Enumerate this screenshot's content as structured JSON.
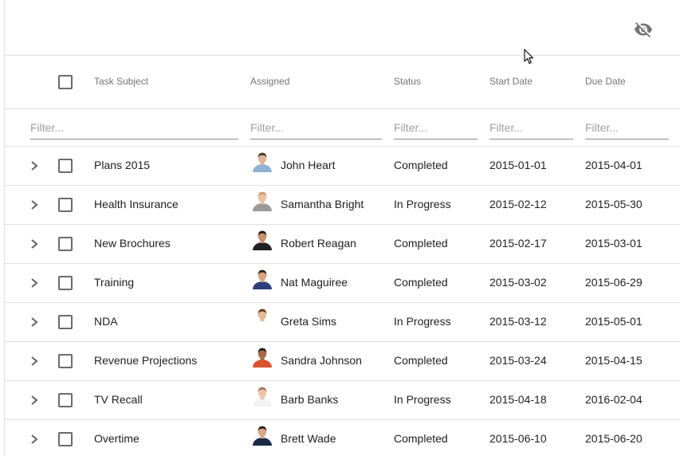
{
  "columns": {
    "task_subject": "Task Subject",
    "assigned": "Assigned",
    "status": "Status",
    "start_date": "Start Date",
    "due_date": "Due Date"
  },
  "filters": {
    "placeholder": "Filter..."
  },
  "toolbar": {
    "hide_icon": "eye-off-icon"
  },
  "rows": [
    {
      "subject": "Plans 2015",
      "assigned": "John Heart",
      "status": "Completed",
      "start": "2015-01-01",
      "due": "2015-04-01",
      "avatar": {
        "skin": "#e0b49a",
        "hair": "#4a3323",
        "shirt": "#8fb3d6"
      }
    },
    {
      "subject": "Health Insurance",
      "assigned": "Samantha Bright",
      "status": "In Progress",
      "start": "2015-02-12",
      "due": "2015-05-30",
      "avatar": {
        "skin": "#e9c3a6",
        "hair": "#c9a26b",
        "shirt": "#9a9a9a"
      }
    },
    {
      "subject": "New Brochures",
      "assigned": "Robert Reagan",
      "status": "Completed",
      "start": "2015-02-17",
      "due": "2015-03-01",
      "avatar": {
        "skin": "#c9906b",
        "hair": "#1f1712",
        "shirt": "#222222"
      }
    },
    {
      "subject": "Training",
      "assigned": "Nat Maguiree",
      "status": "Completed",
      "start": "2015-03-02",
      "due": "2015-06-29",
      "avatar": {
        "skin": "#d6a283",
        "hair": "#2e2017",
        "shirt": "#2d3e78"
      }
    },
    {
      "subject": "NDA",
      "assigned": "Greta Sims",
      "status": "In Progress",
      "start": "2015-03-12",
      "due": "2015-05-01",
      "avatar": {
        "skin": "#e6b99a",
        "hair": "#6b3a1e",
        "shirt": "#ffffff"
      }
    },
    {
      "subject": "Revenue Projections",
      "assigned": "Sandra Johnson",
      "status": "Completed",
      "start": "2015-03-24",
      "due": "2015-04-15",
      "avatar": {
        "skin": "#a86a48",
        "hair": "#2a1710",
        "shirt": "#d9532f"
      }
    },
    {
      "subject": "TV Recall",
      "assigned": "Barb Banks",
      "status": "In Progress",
      "start": "2015-04-18",
      "due": "2016-02-04",
      "avatar": {
        "skin": "#ebc6ad",
        "hair": "#a87956",
        "shirt": "#f2f2f2"
      }
    },
    {
      "subject": "Overtime",
      "assigned": "Brett Wade",
      "status": "Completed",
      "start": "2015-06-10",
      "due": "2015-06-20",
      "avatar": {
        "skin": "#d9a88a",
        "hair": "#2a1c14",
        "shirt": "#1b2a44"
      }
    }
  ]
}
